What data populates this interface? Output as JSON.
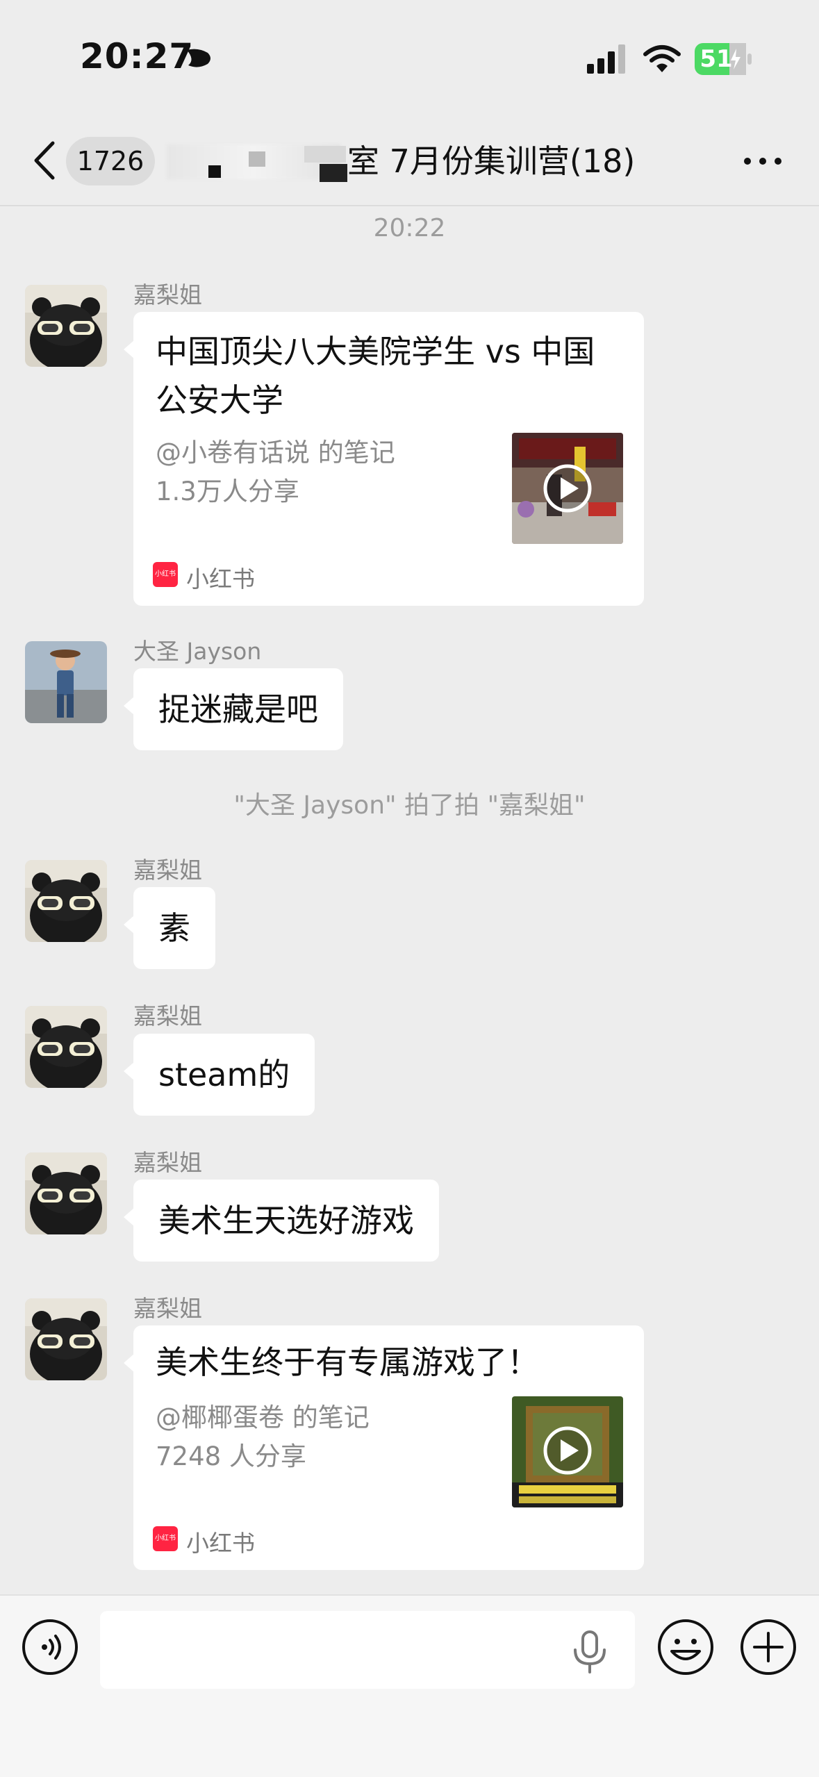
{
  "status_bar": {
    "time": "20:27",
    "battery": "51"
  },
  "nav": {
    "unread_badge": "1726",
    "title": "室 7月份集训营(18)"
  },
  "messages": [
    {
      "type": "time",
      "text": "20:22"
    },
    {
      "type": "card",
      "sender": "嘉梨姐",
      "title": "中国顶尖八大美院学生 vs 中国公安大学",
      "author": "@小卷有话说 的笔记",
      "shares": "1.3万人分享",
      "source": "小红书"
    },
    {
      "type": "text",
      "sender": "大圣 Jayson",
      "text": "捉迷藏是吧"
    },
    {
      "type": "system",
      "text": "\"大圣 Jayson\" 拍了拍 \"嘉梨姐\""
    },
    {
      "type": "text",
      "sender": "嘉梨姐",
      "text": "素"
    },
    {
      "type": "text",
      "sender": "嘉梨姐",
      "text": "steam的"
    },
    {
      "type": "text",
      "sender": "嘉梨姐",
      "text": "美术生天选好游戏"
    },
    {
      "type": "card",
      "sender": "嘉梨姐",
      "title": "美术生终于有专属游戏了！",
      "author": "@椰椰蛋卷 的笔记",
      "shares": "7248 人分享",
      "source": "小红书"
    }
  ],
  "source_icon_label": "小红书",
  "icons": [
    "back-icon",
    "more-icon",
    "voice-icon",
    "mic-icon",
    "emoji-icon",
    "plus-icon",
    "play-icon"
  ]
}
